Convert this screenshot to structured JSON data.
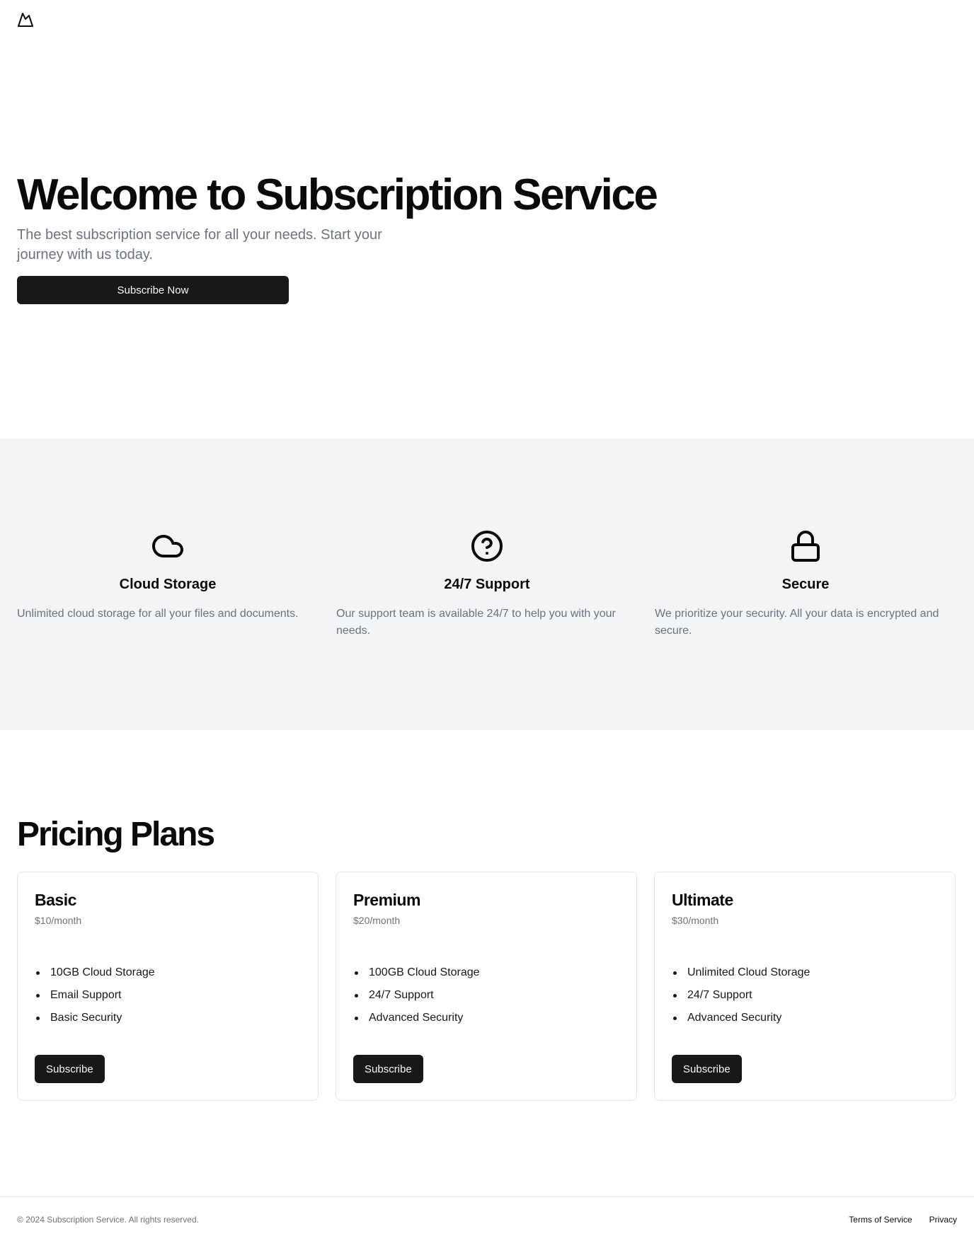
{
  "header": {
    "logo_icon": "mountain-icon"
  },
  "hero": {
    "title": "Welcome to Subscription Service",
    "subtitle": "The best subscription service for all your needs. Start your journey with us today.",
    "cta_label": "Subscribe Now"
  },
  "features": [
    {
      "icon": "cloud-icon",
      "title": "Cloud Storage",
      "description": "Unlimited cloud storage for all your files and documents."
    },
    {
      "icon": "help-circle-icon",
      "title": "24/7 Support",
      "description": "Our support team is available 24/7 to help you with your needs."
    },
    {
      "icon": "lock-icon",
      "title": "Secure",
      "description": "We prioritize your security. All your data is encrypted and secure."
    }
  ],
  "pricing": {
    "title": "Pricing Plans",
    "plans": [
      {
        "name": "Basic",
        "price": "$10/month",
        "features": [
          "10GB Cloud Storage",
          "Email Support",
          "Basic Security"
        ],
        "button": "Subscribe"
      },
      {
        "name": "Premium",
        "price": "$20/month",
        "features": [
          "100GB Cloud Storage",
          "24/7 Support",
          "Advanced Security"
        ],
        "button": "Subscribe"
      },
      {
        "name": "Ultimate",
        "price": "$30/month",
        "features": [
          "Unlimited Cloud Storage",
          "24/7 Support",
          "Advanced Security"
        ],
        "button": "Subscribe"
      }
    ]
  },
  "footer": {
    "copyright": "© 2024 Subscription Service. All rights reserved.",
    "links": [
      "Terms of Service",
      "Privacy"
    ]
  },
  "colors": {
    "primary": "#18181b",
    "muted_text": "#6b7280",
    "section_bg": "#f3f4f6",
    "border": "#e4e4e7"
  }
}
